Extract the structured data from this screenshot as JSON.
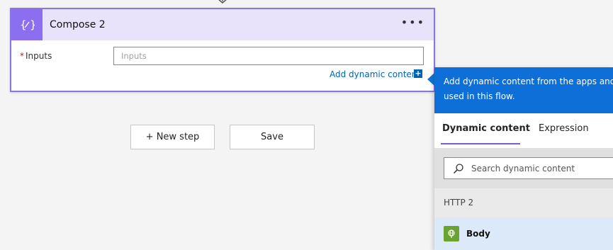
{
  "card": {
    "title": "Compose 2",
    "more_label": "•••",
    "inputs_label": "Inputs",
    "required_mark": "*",
    "inputs_placeholder": "Inputs",
    "add_dynamic_label": "Add dynamic content",
    "add_dynamic_icon": "+"
  },
  "buttons": {
    "new_step": "+ New step",
    "save": "Save"
  },
  "panel": {
    "description": "Add dynamic content from the apps and c used in this flow.",
    "description_line1": "Add dynamic content from the apps and c",
    "description_line2": "used in this flow.",
    "tabs": [
      {
        "label": "Dynamic content",
        "active": true
      },
      {
        "label": "Expression",
        "active": false
      }
    ],
    "search_placeholder": "Search dynamic content",
    "section_title": "HTTP 2",
    "items": [
      {
        "label": "Body",
        "icon": "http-globe-icon"
      }
    ]
  },
  "colors": {
    "accent_purple": "#8c6ff0",
    "header_blue": "#0f6fd8",
    "link_blue": "#0063b1",
    "http_green": "#6aa330"
  }
}
